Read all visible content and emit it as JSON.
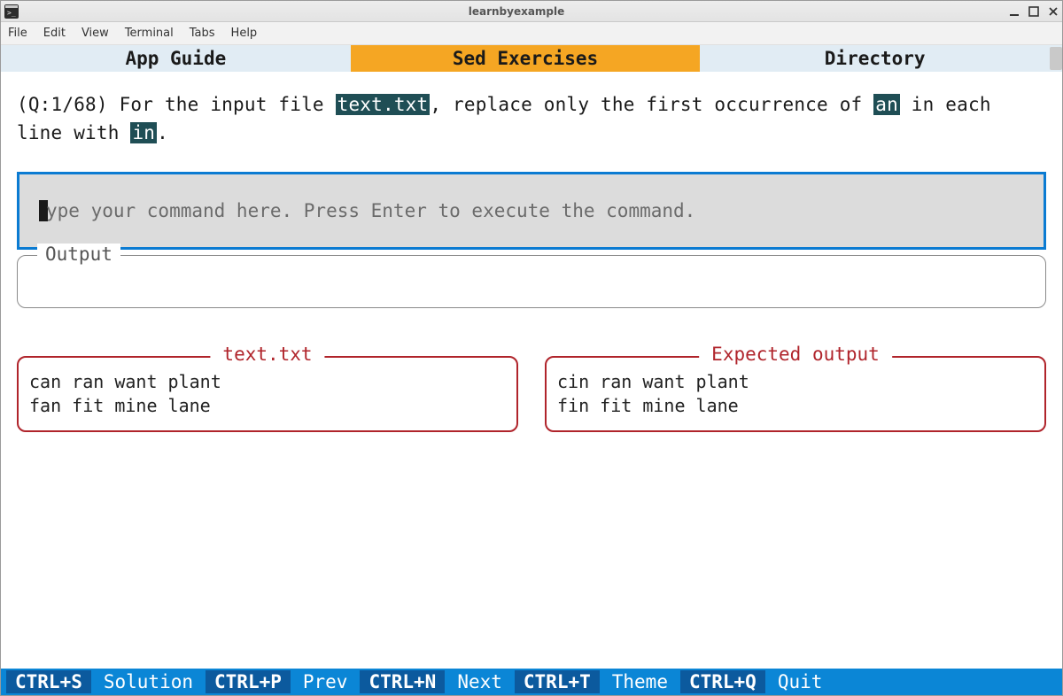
{
  "window": {
    "title": "learnbyexample"
  },
  "menu": {
    "items": [
      "File",
      "Edit",
      "View",
      "Terminal",
      "Tabs",
      "Help"
    ]
  },
  "tabs": {
    "items": [
      "App Guide",
      "Sed Exercises",
      "Directory"
    ],
    "active_index": 1
  },
  "question": {
    "prefix": "(Q:1/68) For the input file ",
    "file": "text.txt",
    "mid1": ", replace only the first occurrence of ",
    "target": "an",
    "mid2": " in each line with ",
    "replacement": "in",
    "suffix": "."
  },
  "command_input": {
    "placeholder": "ype your command here. Press Enter to execute the command.",
    "value": ""
  },
  "output": {
    "label": "Output",
    "text": ""
  },
  "panels": {
    "left": {
      "title": "text.txt",
      "lines": [
        "can ran want plant",
        "fan fit mine lane"
      ]
    },
    "right": {
      "title": "Expected output",
      "lines": [
        "cin ran want plant",
        "fin fit mine lane"
      ]
    }
  },
  "footer": {
    "items": [
      {
        "key": "CTRL+S",
        "label": "Solution"
      },
      {
        "key": "CTRL+P",
        "label": "Prev"
      },
      {
        "key": "CTRL+N",
        "label": "Next"
      },
      {
        "key": "CTRL+T",
        "label": "Theme"
      },
      {
        "key": "CTRL+Q",
        "label": "Quit"
      }
    ]
  }
}
